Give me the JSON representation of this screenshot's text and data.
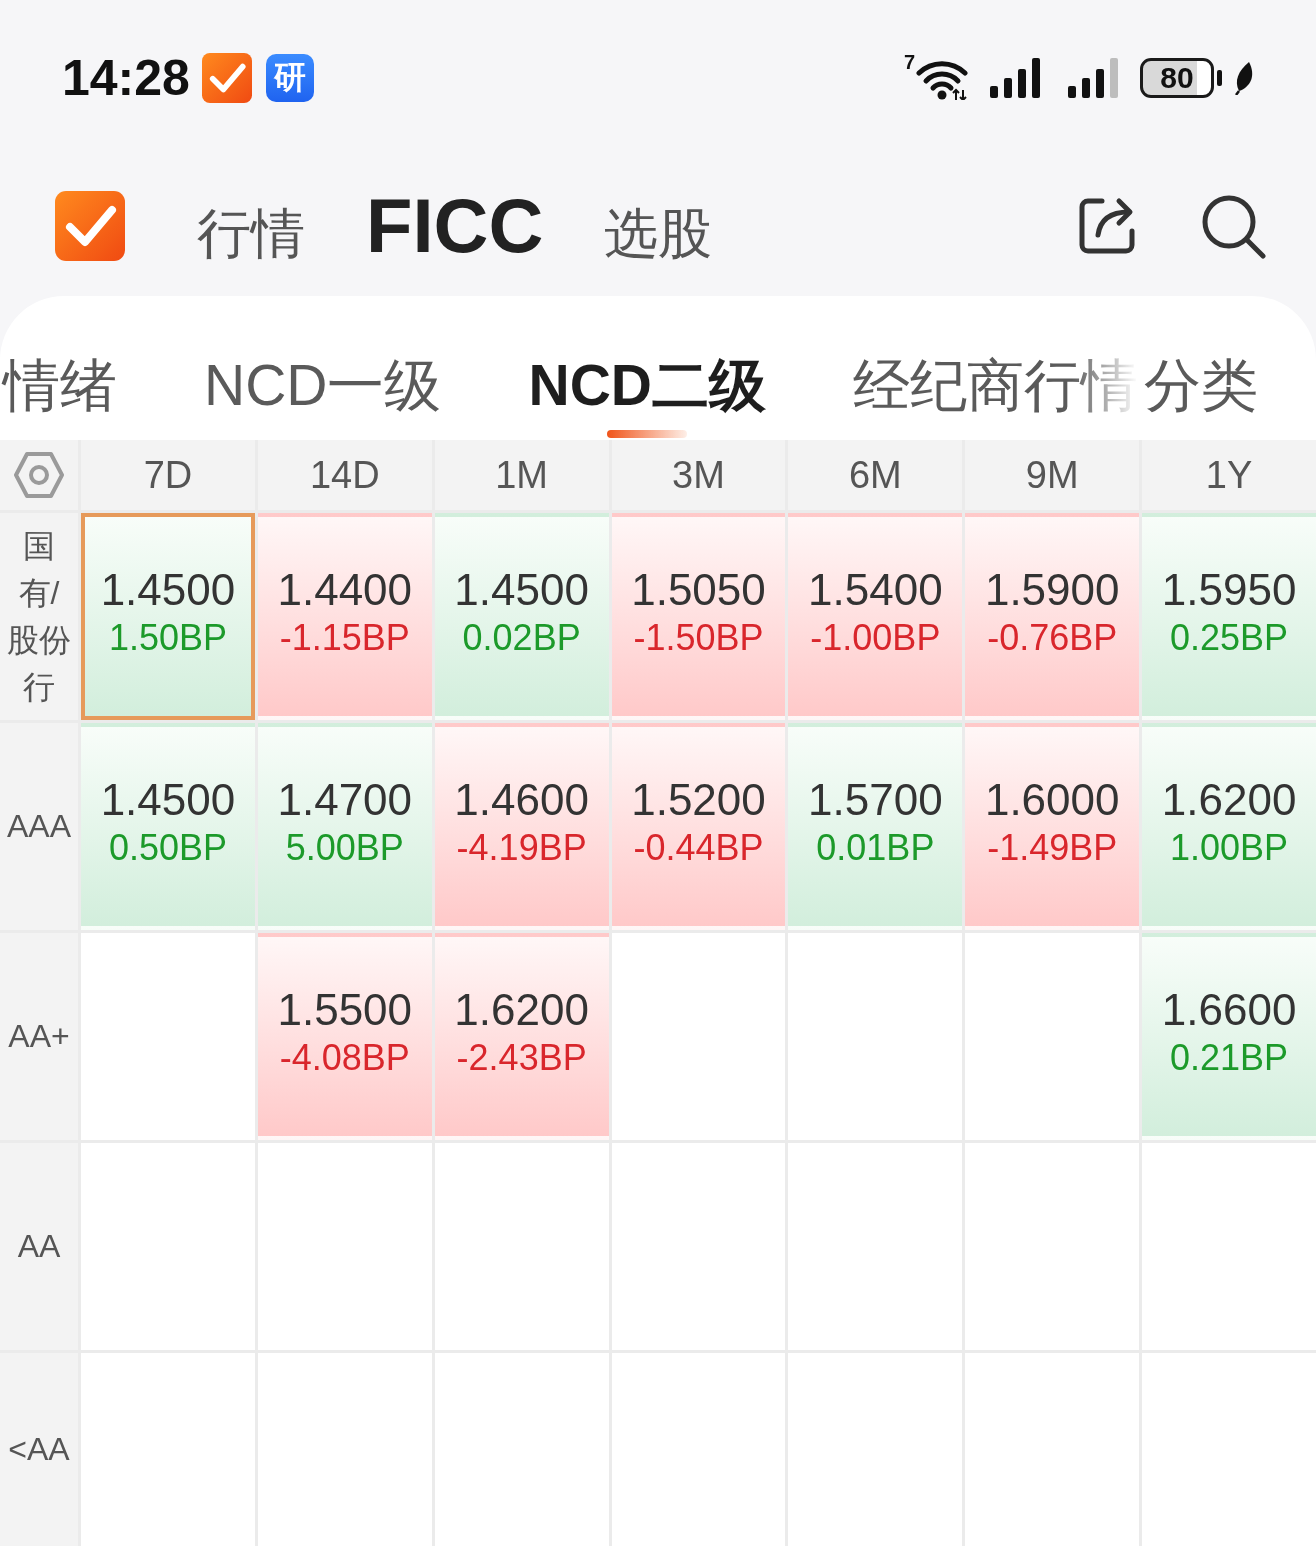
{
  "status_bar": {
    "time": "14:28",
    "app_badge": "研",
    "wifi_standard": "7",
    "battery": "80"
  },
  "header": {
    "nav_tabs": [
      {
        "label": "行情",
        "selected": false
      },
      {
        "label": "FICC",
        "selected": true
      },
      {
        "label": "选股",
        "selected": false
      }
    ]
  },
  "sub_tabs": {
    "tabs": [
      {
        "label": "情绪",
        "selected": false
      },
      {
        "label": "NCD一级",
        "selected": false
      },
      {
        "label": "NCD二级",
        "selected": true
      },
      {
        "label": "经纪商行情",
        "selected": false
      }
    ],
    "category_button": "分类"
  },
  "table": {
    "columns": [
      "7D",
      "14D",
      "1M",
      "3M",
      "6M",
      "9M",
      "1Y"
    ],
    "rows": [
      {
        "label": "国有/股份行",
        "cells": [
          {
            "kind": "up",
            "value": "1.4500",
            "change": "1.50BP",
            "selected": true
          },
          {
            "kind": "down",
            "value": "1.4400",
            "change": "-1.15BP",
            "selected": false
          },
          {
            "kind": "up",
            "value": "1.4500",
            "change": "0.02BP",
            "selected": false
          },
          {
            "kind": "down",
            "value": "1.5050",
            "change": "-1.50BP",
            "selected": false
          },
          {
            "kind": "down",
            "value": "1.5400",
            "change": "-1.00BP",
            "selected": false
          },
          {
            "kind": "down",
            "value": "1.5900",
            "change": "-0.76BP",
            "selected": false
          },
          {
            "kind": "up",
            "value": "1.5950",
            "change": "0.25BP",
            "selected": false
          }
        ]
      },
      {
        "label": "AAA",
        "cells": [
          {
            "kind": "up",
            "value": "1.4500",
            "change": "0.50BP",
            "selected": false
          },
          {
            "kind": "up",
            "value": "1.4700",
            "change": "5.00BP",
            "selected": false
          },
          {
            "kind": "down",
            "value": "1.4600",
            "change": "-4.19BP",
            "selected": false
          },
          {
            "kind": "down",
            "value": "1.5200",
            "change": "-0.44BP",
            "selected": false
          },
          {
            "kind": "up",
            "value": "1.5700",
            "change": "0.01BP",
            "selected": false
          },
          {
            "kind": "down",
            "value": "1.6000",
            "change": "-1.49BP",
            "selected": false
          },
          {
            "kind": "up",
            "value": "1.6200",
            "change": "1.00BP",
            "selected": false
          }
        ]
      },
      {
        "label": "AA+",
        "cells": [
          {
            "kind": "empty",
            "selected": false
          },
          {
            "kind": "down",
            "value": "1.5500",
            "change": "-4.08BP",
            "selected": false
          },
          {
            "kind": "down",
            "value": "1.6200",
            "change": "-2.43BP",
            "selected": false
          },
          {
            "kind": "empty",
            "selected": false
          },
          {
            "kind": "empty",
            "selected": false
          },
          {
            "kind": "empty",
            "selected": false
          },
          {
            "kind": "up",
            "value": "1.6600",
            "change": "0.21BP",
            "selected": false
          }
        ]
      },
      {
        "label": "AA",
        "cells": [
          {
            "kind": "empty",
            "selected": false
          },
          {
            "kind": "empty",
            "selected": false
          },
          {
            "kind": "empty",
            "selected": false
          },
          {
            "kind": "empty",
            "selected": false
          },
          {
            "kind": "empty",
            "selected": false
          },
          {
            "kind": "empty",
            "selected": false
          },
          {
            "kind": "empty",
            "selected": false
          }
        ]
      },
      {
        "label": "<AA",
        "cells": [
          {
            "kind": "empty",
            "selected": false
          },
          {
            "kind": "empty",
            "selected": false
          },
          {
            "kind": "empty",
            "selected": false
          },
          {
            "kind": "empty",
            "selected": false
          },
          {
            "kind": "empty",
            "selected": false
          },
          {
            "kind": "empty",
            "selected": false
          },
          {
            "kind": "empty",
            "selected": false
          }
        ]
      }
    ]
  }
}
